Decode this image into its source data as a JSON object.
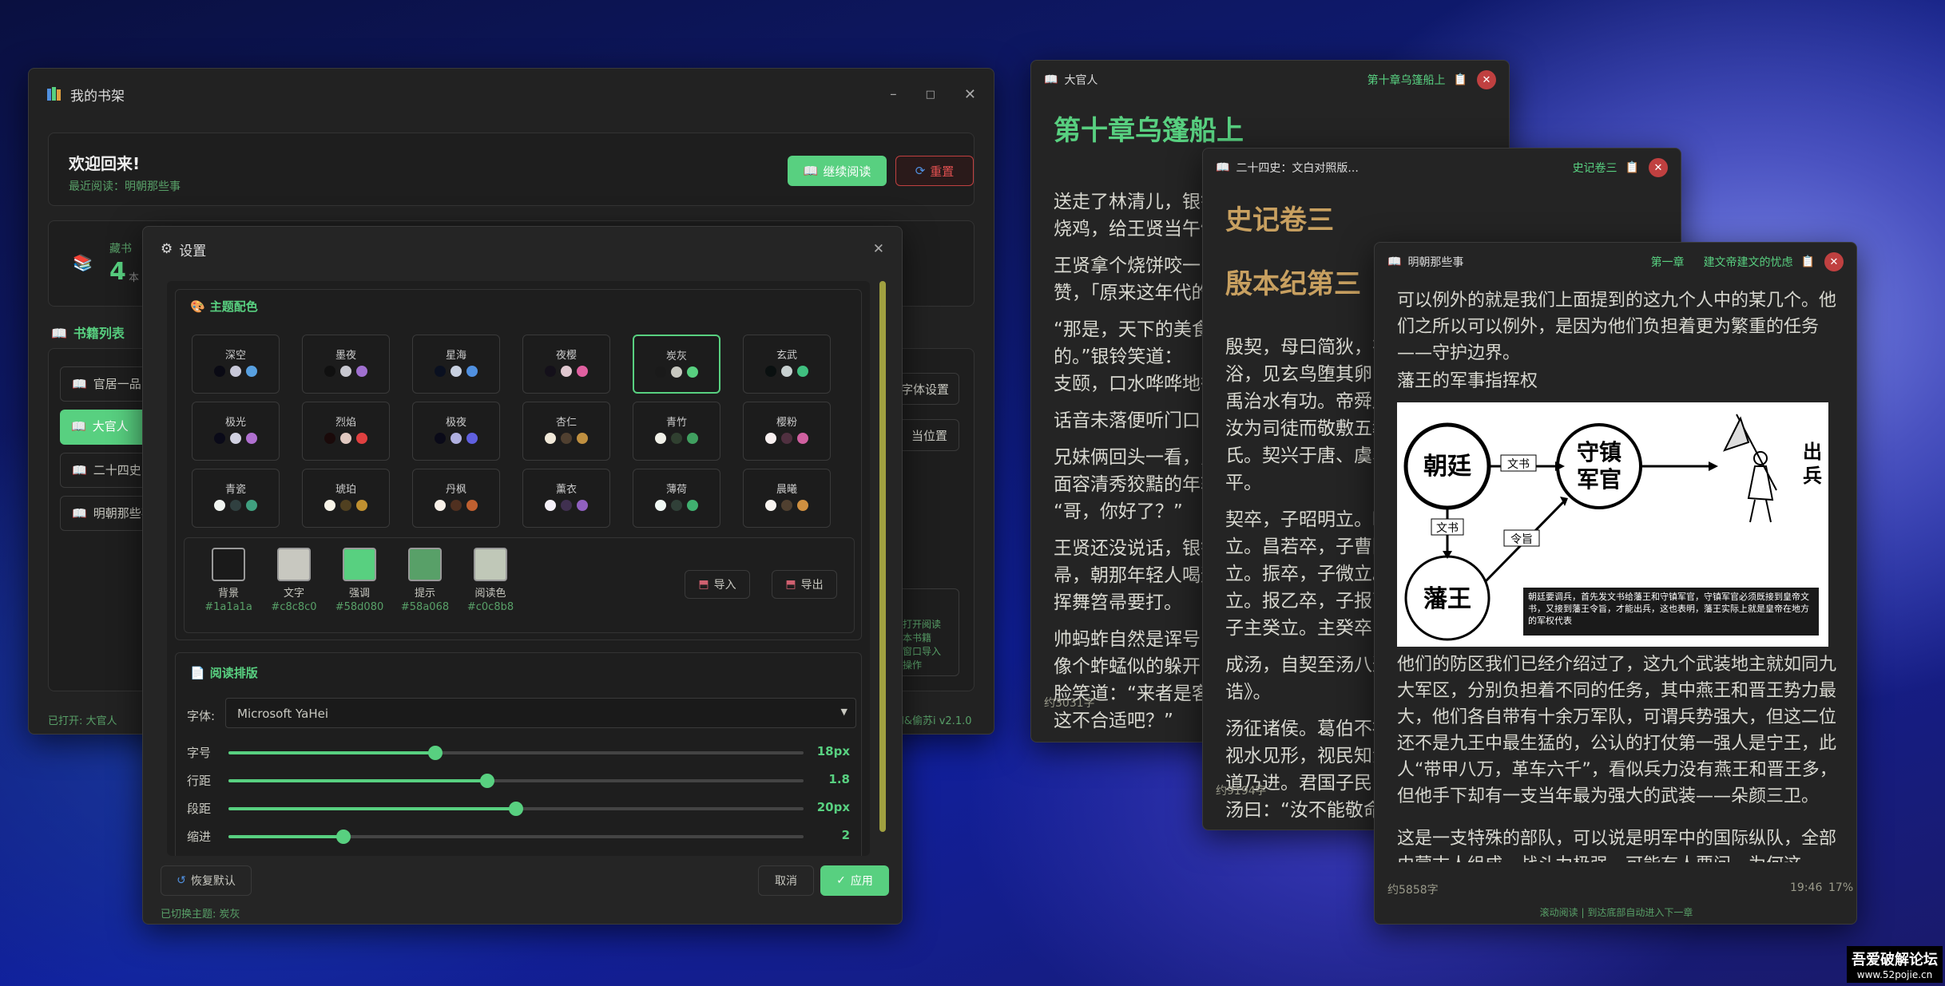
{
  "shelf": {
    "title": "我的书架",
    "welcome": "欢迎回来!",
    "recent": "最近阅读：明朝那些事",
    "continue_btn": "继续阅读",
    "reset_btn": "重置",
    "stat_label": "藏书",
    "stat_value": "4",
    "stat_unit": "本",
    "list_title": "书籍列表",
    "books": [
      "官居一品",
      "大官人",
      "二十四史",
      "明朝那些事"
    ],
    "side_btns": [
      "字体设置",
      "当位置"
    ],
    "tips": [
      "打开阅读",
      "本书籍",
      "窗口导入",
      "操作"
    ],
    "status_left": "已打开: 大官人",
    "status_right": "ill&偷苏i  v2.1.0"
  },
  "settings": {
    "title": "设置",
    "theme_title": "主题配色",
    "themes": [
      {
        "name": "深空",
        "colors": [
          "#0a0a14",
          "#c8c8d8",
          "#58a0e0"
        ]
      },
      {
        "name": "墨夜",
        "colors": [
          "#101010",
          "#c8c8d0",
          "#a070d0"
        ]
      },
      {
        "name": "星海",
        "colors": [
          "#0a1020",
          "#c8d0e0",
          "#5090e0"
        ]
      },
      {
        "name": "夜樱",
        "colors": [
          "#14101a",
          "#e0c8d0",
          "#e060a0"
        ]
      },
      {
        "name": "炭灰",
        "colors": [
          "#1a1a1a",
          "#c8c8c0",
          "#58d080"
        ]
      },
      {
        "name": "玄武",
        "colors": [
          "#0a1010",
          "#c8d0d0",
          "#40c080"
        ]
      },
      {
        "name": "极光",
        "colors": [
          "#0a0a18",
          "#d0d0e0",
          "#b070d0"
        ]
      },
      {
        "name": "烈焰",
        "colors": [
          "#1a0a0a",
          "#e0c8c0",
          "#e04040"
        ]
      },
      {
        "name": "极夜",
        "colors": [
          "#0a0a18",
          "#b0b0e0",
          "#6060e0"
        ]
      },
      {
        "name": "杏仁",
        "colors": [
          "#f0e8d8",
          "#504030",
          "#c09040"
        ]
      },
      {
        "name": "青竹",
        "colors": [
          "#f0f0e8",
          "#304030",
          "#40a060"
        ]
      },
      {
        "name": "樱粉",
        "colors": [
          "#f8f0f0",
          "#503040",
          "#d060a0"
        ]
      },
      {
        "name": "青瓷",
        "colors": [
          "#f0f4f0",
          "#304040",
          "#40a080"
        ]
      },
      {
        "name": "琥珀",
        "colors": [
          "#f8f4e8",
          "#504020",
          "#c09030"
        ]
      },
      {
        "name": "丹枫",
        "colors": [
          "#f8f0e8",
          "#503020",
          "#c06030"
        ]
      },
      {
        "name": "薰衣",
        "colors": [
          "#f4f0f8",
          "#403050",
          "#9060c0"
        ]
      },
      {
        "name": "薄荷",
        "colors": [
          "#f0f8f4",
          "#304038",
          "#40b070"
        ]
      },
      {
        "name": "晨曦",
        "colors": [
          "#f8f4f0",
          "#504030",
          "#d09040"
        ]
      }
    ],
    "selected_theme": "炭灰",
    "custom": [
      {
        "label": "背景",
        "hex": "#1a1a1a"
      },
      {
        "label": "文字",
        "hex": "#c8c8c0"
      },
      {
        "label": "强调",
        "hex": "#58d080"
      },
      {
        "label": "提示",
        "hex": "#58a068"
      },
      {
        "label": "阅读色",
        "hex": "#c0c8b8"
      }
    ],
    "import_btn": "导入",
    "export_btn": "导出",
    "layout_title": "阅读排版",
    "font_label": "字体:",
    "font_value": "Microsoft YaHei",
    "sliders": [
      {
        "label": "字号",
        "value": "18px",
        "level": 0.36
      },
      {
        "label": "行距",
        "value": "1.8",
        "level": 0.45
      },
      {
        "label": "段距",
        "value": "20px",
        "level": 0.5
      },
      {
        "label": "缩进",
        "value": "2",
        "level": 0.2
      }
    ],
    "restore_btn": "恢复默认",
    "cancel_btn": "取消",
    "apply_btn": "应用",
    "status": "已切换主题: 炭灰"
  },
  "reader1": {
    "title": "大官人",
    "chapter_link": "第十章乌篷船上",
    "heading": "第十章乌篷船上",
    "paras": [
      "送走了林清儿，银铃",
      "烧鸡，给王贤当午饭",
      "王贤拿个烧饼咬一口",
      "赞，「原来这年代的",
      "“那是，天下的美食",
      "的。”银铃笑道：",
      "支颐，口水哗哗地往",
      "话音未落便听门口",
      "兄妹俩回头一看，只",
      "面容清秀狡黠的年轻",
      "“哥，你好了？”",
      "王贤还没说话，银铃",
      "帚，朝那年轻人喝道",
      "挥舞笤帚要打。",
      "帅蚂蚱自然是诨号，",
      "像个蚱蜢似的躲开，",
      "脸笑道：“来者是客",
      "这不合适吧？”"
    ],
    "words": "约3031字"
  },
  "reader2": {
    "title": "二十四史：文白对照版...",
    "chapter_link": "史记卷三",
    "heading1": "史记卷三",
    "heading2": "殷本纪第三",
    "paras": [
      "殷契，母曰简狄，有",
      "浴，见玄鸟堕其卵，",
      "禹治水有功。帝舜乃",
      "汝为司徒而敬敷五教",
      "氏。契兴于唐、虞、",
      "平。",
      "契卒，子昭明立。昭",
      "立。昌若卒，子曹圉",
      "立。振卒，子微立。",
      "立。报乙卒，子报丙",
      "子主癸立。主癸卒，",
      "成汤，自契至汤八迁",
      "诰》。",
      "汤征诸侯。葛伯不祀",
      "视水见形，视民知治",
      "道乃进。君国子民，",
      "汤曰：“汝不能敬命"
    ],
    "words": "约9194字"
  },
  "reader3": {
    "title": "明朝那些事",
    "chapter_link1": "第一章",
    "chapter_link2": "建文帝建文的忧虑",
    "p1": "可以例外的就是我们上面提到的这九个人中的某几个。他们之所以可以例外，是因为他们负担着更为繁重的任务——守护边界。",
    "sub": "藩王的军事指挥权",
    "diagram": {
      "court": "朝廷",
      "guard1": "守镇",
      "guard2": "军官",
      "king": "藩王",
      "out1": "出",
      "out2": "兵",
      "doc1": "文书",
      "doc2": "文书",
      "order": "令旨",
      "note": "朝廷要调兵，首先发文书给藩王和守镇军官，守镇军官必须既接到皇帝文书，又接到藩王令旨，才能出兵，这也表明，藩王实际上就是皇帝在地方的军权代表"
    },
    "p2": "他们的防区我们已经介绍过了，这九个武装地主就如同九大军区，分别负担着不同的任务，其中燕王和晋王势力最大，他们各自带有十余万军队，可谓兵势强大，但这二位还不是九王中最生猛的，公认的打仗第一强人是宁王，此人“带甲八万，革车六千”，看似兵力没有燕王和晋王多，但他手下却有一支当年最为强大的武装——朵颜三卫。",
    "p3": "这是一支特殊的部队，可以说是明军中的国际纵队，全部由蒙古人组成，战斗力极强，可能有人要问，为何这",
    "words": "约5858字",
    "time": "19:46",
    "percent": "17%",
    "hint": "滚动阅读 | 到达底部自动进入下一章"
  },
  "watermark": {
    "line1": "吾爱破解论坛",
    "line2": "www.52pojie.cn"
  }
}
